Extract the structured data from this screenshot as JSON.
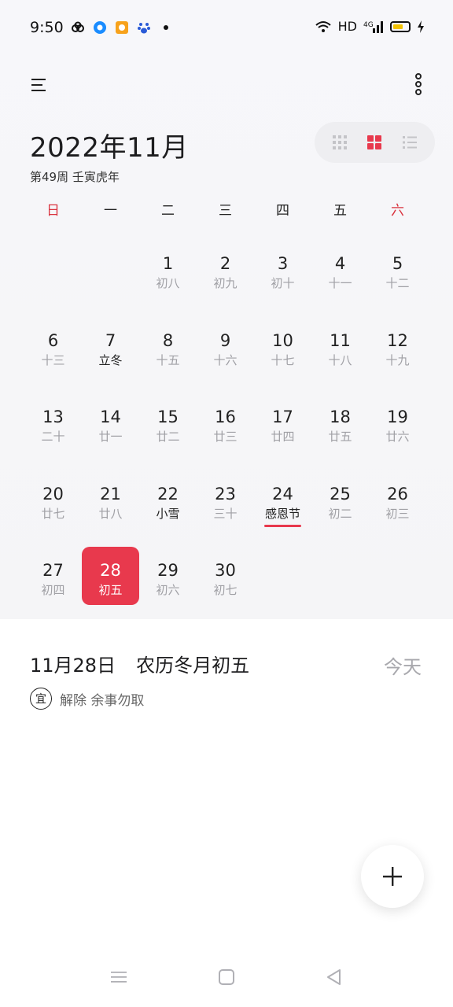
{
  "status_bar": {
    "time": "9:50",
    "network": "HD",
    "signal": "4G",
    "app_icons": [
      "cloud-icon",
      "browser-icon",
      "app-icon",
      "baidu-icon"
    ]
  },
  "header": {
    "month_title": "2022年11月",
    "week_info": "第49周 壬寅虎年",
    "view_modes": [
      "month-grid-small",
      "month-grid",
      "list"
    ],
    "active_view": "month-grid"
  },
  "weekdays": [
    "日",
    "一",
    "二",
    "三",
    "四",
    "五",
    "六"
  ],
  "calendar": {
    "weeks": [
      [
        {
          "day": "",
          "sub": ""
        },
        {
          "day": "",
          "sub": ""
        },
        {
          "day": "1",
          "sub": "初八"
        },
        {
          "day": "2",
          "sub": "初九"
        },
        {
          "day": "3",
          "sub": "初十"
        },
        {
          "day": "4",
          "sub": "十一"
        },
        {
          "day": "5",
          "sub": "十二"
        }
      ],
      [
        {
          "day": "6",
          "sub": "十三"
        },
        {
          "day": "7",
          "sub": "立冬",
          "highlight": true
        },
        {
          "day": "8",
          "sub": "十五"
        },
        {
          "day": "9",
          "sub": "十六"
        },
        {
          "day": "10",
          "sub": "十七"
        },
        {
          "day": "11",
          "sub": "十八"
        },
        {
          "day": "12",
          "sub": "十九"
        }
      ],
      [
        {
          "day": "13",
          "sub": "二十"
        },
        {
          "day": "14",
          "sub": "廿一"
        },
        {
          "day": "15",
          "sub": "廿二"
        },
        {
          "day": "16",
          "sub": "廿三"
        },
        {
          "day": "17",
          "sub": "廿四"
        },
        {
          "day": "18",
          "sub": "廿五"
        },
        {
          "day": "19",
          "sub": "廿六"
        }
      ],
      [
        {
          "day": "20",
          "sub": "廿七"
        },
        {
          "day": "21",
          "sub": "廿八"
        },
        {
          "day": "22",
          "sub": "小雪",
          "highlight": true
        },
        {
          "day": "23",
          "sub": "三十"
        },
        {
          "day": "24",
          "sub": "感恩节",
          "highlight": true,
          "holiday": true
        },
        {
          "day": "25",
          "sub": "初二"
        },
        {
          "day": "26",
          "sub": "初三"
        }
      ],
      [
        {
          "day": "27",
          "sub": "初四"
        },
        {
          "day": "28",
          "sub": "初五",
          "selected": true
        },
        {
          "day": "29",
          "sub": "初六"
        },
        {
          "day": "30",
          "sub": "初七"
        },
        {
          "day": "",
          "sub": ""
        },
        {
          "day": "",
          "sub": ""
        },
        {
          "day": "",
          "sub": ""
        }
      ]
    ]
  },
  "selected_info": {
    "date": "11月28日",
    "lunar": "农历冬月初五",
    "today_label": "今天",
    "yi_badge": "宜",
    "yi_text": "解除 余事勿取"
  },
  "colors": {
    "accent": "#e8394d",
    "weekend": "#d9333f",
    "muted": "#a0a0a5"
  }
}
